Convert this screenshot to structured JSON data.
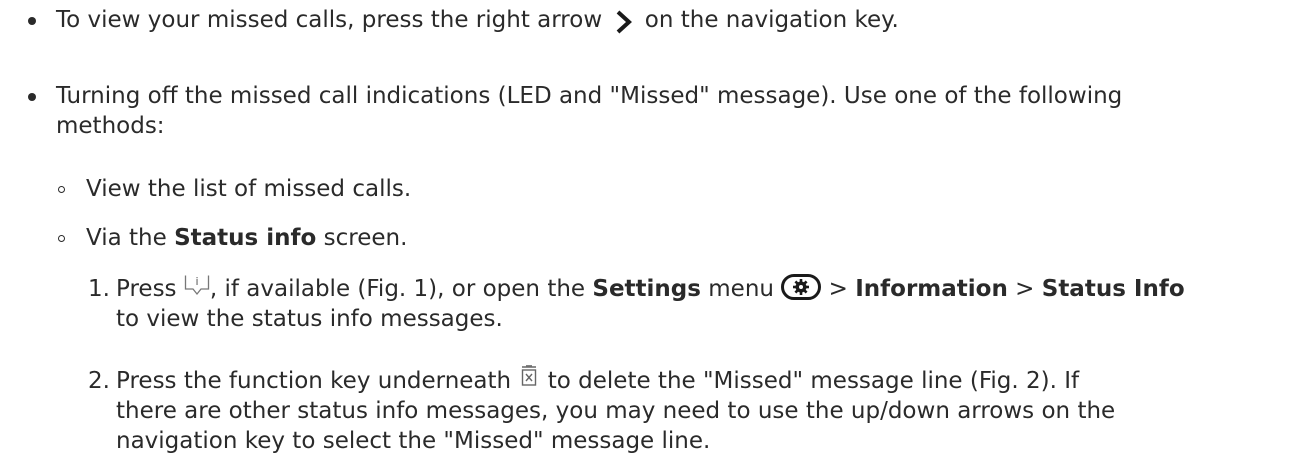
{
  "bullets": [
    {
      "pre": "To view your missed calls, press the right arrow",
      "post": "on the navigation key.",
      "icon": "right-chevron-icon"
    },
    {
      "line1": "Turning off the missed call indications (LED and \"Missed\" message).  Use one of the following",
      "line2": "methods:"
    }
  ],
  "subbullets": [
    {
      "text": "View the list of missed calls."
    },
    {
      "pre": "Via the ",
      "bold": "Status info",
      "post": " screen."
    }
  ],
  "steps": [
    {
      "num": "1.",
      "press": "Press",
      "icon1": "info-key-icon",
      "mid": ", if available (Fig. 1), or open the ",
      "settings": "Settings",
      "menu": " menu",
      "icon2": "settings-gear-icon",
      "sep1": " > ",
      "information": "Information",
      "sep2": " > ",
      "status_info": "Status Info",
      "line2": "to view the status info messages."
    },
    {
      "num": "2.",
      "pre": "Press the function key underneath",
      "icon": "delete-bin-icon",
      "post": "to delete the \"Missed\" message line (Fig. 2).  If",
      "line2": "there are other status info messages, you may need to use the up/down arrows on the",
      "line3": "navigation key to select the \"Missed\" message line."
    }
  ]
}
